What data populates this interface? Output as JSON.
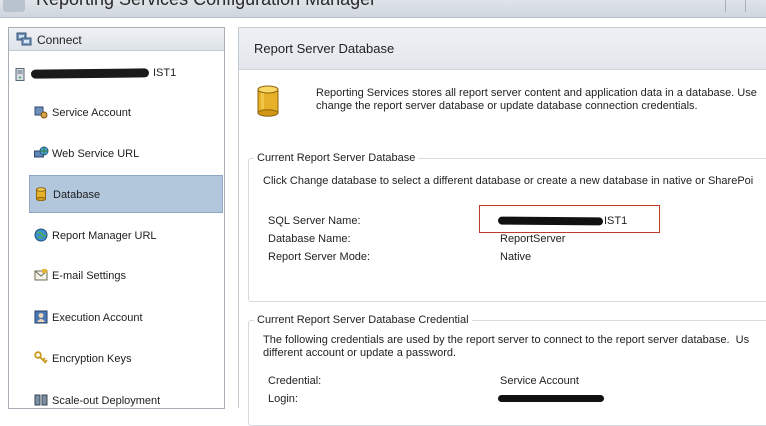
{
  "window": {
    "title": "Reporting Services Configuration Manager"
  },
  "nav": {
    "connect_label": "Connect",
    "server_label_suffix": "IST1",
    "items": [
      {
        "label": "Service Account",
        "icon": "service-account-icon"
      },
      {
        "label": "Web Service URL",
        "icon": "web-service-url-icon"
      },
      {
        "label": "Database",
        "icon": "database-icon",
        "selected": true
      },
      {
        "label": "Report Manager URL",
        "icon": "globe-icon"
      },
      {
        "label": "E-mail Settings",
        "icon": "email-icon"
      },
      {
        "label": "Execution Account",
        "icon": "execution-account-icon"
      },
      {
        "label": "Encryption Keys",
        "icon": "keys-icon"
      },
      {
        "label": "Scale-out Deployment",
        "icon": "scale-out-icon"
      }
    ]
  },
  "main": {
    "title": "Report Server Database",
    "intro": "Reporting Services stores all report server content and application data in a database. Use\nchange the report server database or update database connection credentials.",
    "current_db": {
      "legend": "Current Report Server Database",
      "instructions": "Click Change database to select a different database or create a new database in native or SharePoi",
      "sql_server_name_label": "SQL Server Name:",
      "sql_server_name_suffix": "IST1",
      "database_name_label": "Database Name:",
      "database_name_value": "ReportServer",
      "mode_label": "Report Server Mode:",
      "mode_value": "Native"
    },
    "credential": {
      "legend": "Current Report Server Database Credential",
      "instructions": "The following credentials are used by the report server to connect to the report server database.  Us\ndifferent account or update a password.",
      "credential_label": "Credential:",
      "credential_value": "Service Account",
      "login_label": "Login:"
    }
  }
}
